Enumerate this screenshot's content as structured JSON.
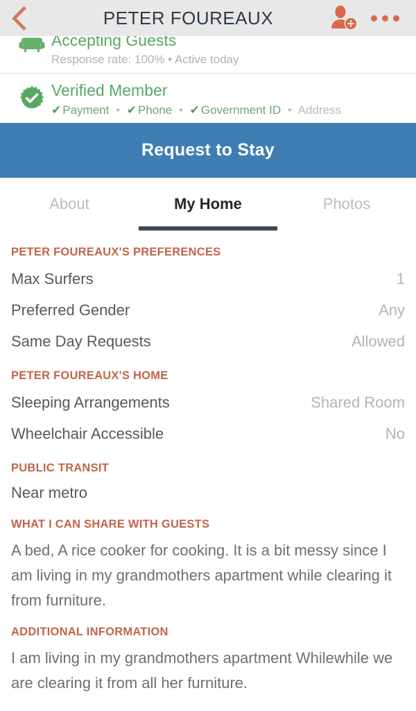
{
  "header": {
    "title": "PETER FOUREAUX",
    "back_icon": "chevron-left-icon",
    "add_person_icon": "add-person-icon",
    "more_icon": "more-options-icon"
  },
  "status": {
    "accepting": {
      "icon": "couch-icon",
      "title": "Accepting Guests",
      "subtitle": "Response rate: 100% • Active  today"
    },
    "verified": {
      "icon": "verified-badge-icon",
      "title": "Verified Member",
      "items": [
        {
          "label": "Payment",
          "verified": true
        },
        {
          "label": "Phone",
          "verified": true
        },
        {
          "label": "Government ID",
          "verified": true
        },
        {
          "label": "Address",
          "verified": false
        }
      ],
      "check_glyph": "✔",
      "separator": "•"
    }
  },
  "banner": {
    "label": "Request to Stay"
  },
  "tabs": [
    {
      "label": "About",
      "active": false
    },
    {
      "label": "My Home",
      "active": true
    },
    {
      "label": "Photos",
      "active": false
    }
  ],
  "sections": {
    "preferences": {
      "heading": "PETER FOUREAUX'S PREFERENCES",
      "rows": [
        {
          "label": "Max Surfers",
          "value": "1"
        },
        {
          "label": "Preferred Gender",
          "value": "Any"
        },
        {
          "label": "Same Day Requests",
          "value": "Allowed"
        }
      ]
    },
    "home": {
      "heading": "PETER FOUREAUX'S HOME",
      "rows": [
        {
          "label": "Sleeping Arrangements",
          "value": "Shared Room"
        },
        {
          "label": "Wheelchair Accessible",
          "value": "No"
        }
      ]
    },
    "public_transit": {
      "heading": "PUBLIC TRANSIT",
      "text": "Near metro"
    },
    "share_with_guests": {
      "heading": "WHAT I CAN SHARE WITH GUESTS",
      "text": "A bed, A rice cooker for cooking. It is a bit messy since I am living in my grandmothers apartment while  clearing it from furniture."
    },
    "additional_information": {
      "heading": "ADDITIONAL INFORMATION",
      "text": "I am living in my grandmothers apartment Whilewhile we are clearing it from all her furniture."
    }
  },
  "colors": {
    "accent_orange": "#d9694a",
    "section_heading": "#c0654a",
    "banner_blue": "#3f7db3",
    "verified_green": "#58a862",
    "tab_active": "#3c4a59"
  }
}
